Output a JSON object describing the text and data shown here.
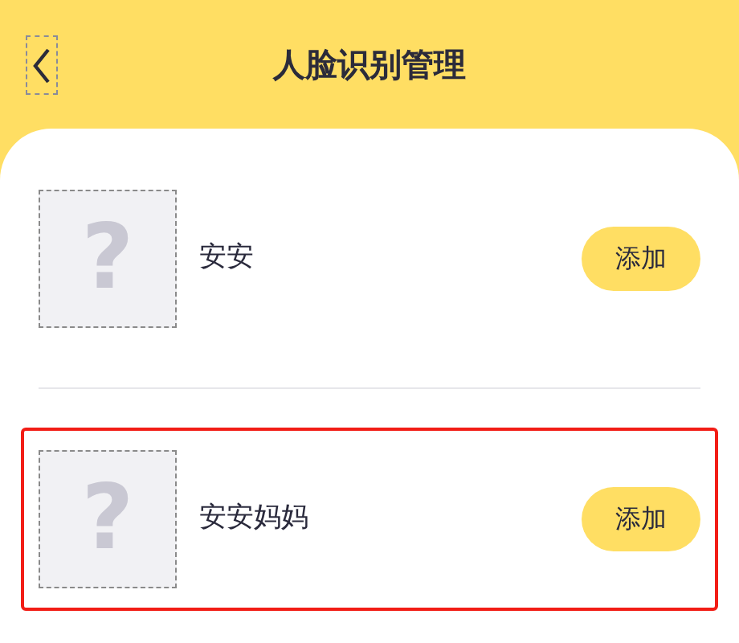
{
  "header": {
    "title": "人脸识别管理"
  },
  "members": [
    {
      "name": "安安",
      "photo_glyph": "?",
      "button": "添加",
      "selected": false
    },
    {
      "name": "安安妈妈",
      "photo_glyph": "?",
      "button": "添加",
      "selected": true
    }
  ]
}
